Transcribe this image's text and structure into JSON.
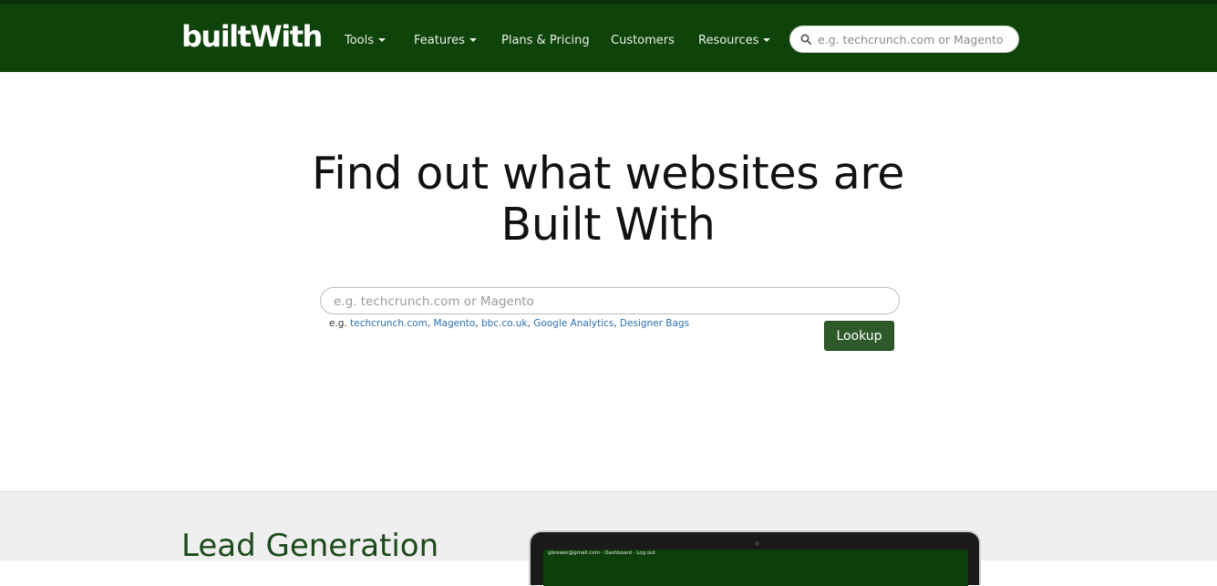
{
  "header": {
    "logo_text": "builtWith",
    "nav": [
      {
        "label": "Tools",
        "has_caret": true
      },
      {
        "label": "Features",
        "has_caret": true
      },
      {
        "label": "Plans & Pricing",
        "has_caret": false
      },
      {
        "label": "Customers",
        "has_caret": false
      },
      {
        "label": "Resources",
        "has_caret": true
      }
    ],
    "search": {
      "placeholder": "e.g. techcrunch.com or Magento",
      "icon": "search-icon"
    },
    "background_color": "#0e4309"
  },
  "hero": {
    "title_line1": "Find out what websites are",
    "title_line2": "Built With",
    "search": {
      "placeholder": "e.g. techcrunch.com or Magento",
      "value": ""
    },
    "examples_prefix": "e.g.",
    "examples": [
      "techcrunch.com",
      "Magento",
      "bbc.co.uk",
      "Google Analytics",
      "Designer Bags"
    ],
    "lookup_label": "Lookup",
    "lookup_color": "#2e5a2a"
  },
  "lower": {
    "title": "Lead Generation",
    "device_text": "gbrewer@gmail.com · Dashboard · Log out"
  }
}
